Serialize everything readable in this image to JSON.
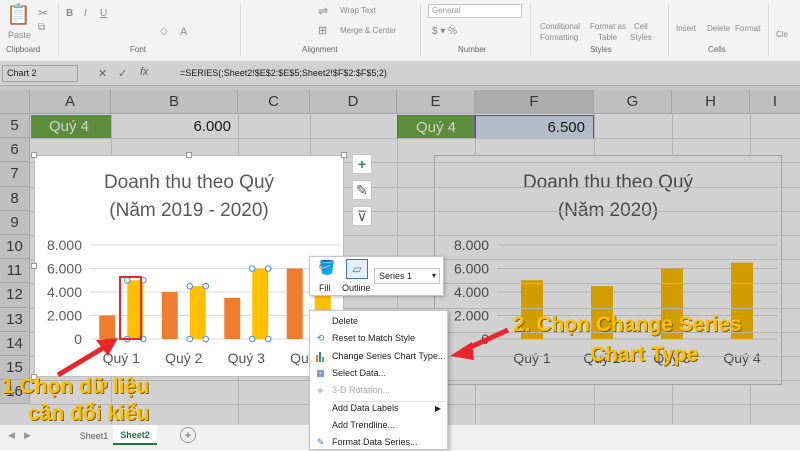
{
  "ribbon": {
    "clipboard": {
      "paste": "Paste",
      "group": "Clipboard"
    },
    "font": {
      "group": "Font"
    },
    "alignment": {
      "wrap_text": "Wrap Text",
      "merge_center": "Merge & Center",
      "group": "Alignment"
    },
    "number": {
      "format": "General",
      "group": "Number"
    },
    "styles": {
      "conditional": "Conditional",
      "formatting": "Formatting",
      "format_as": "Format as",
      "table": "Table",
      "cell": "Cell",
      "styles_lbl": "Styles",
      "group": "Styles"
    },
    "cells": {
      "insert": "Insert",
      "delete": "Delete",
      "format": "Format",
      "group": "Cells"
    },
    "clear": "Cle"
  },
  "formula_bar": {
    "name_box": "Chart 2",
    "formula": "=SERIES(;Sheet2!$E$2:$E$5;Sheet2!$F$2:$F$5;2)"
  },
  "columns": [
    "A",
    "B",
    "C",
    "D",
    "E",
    "F",
    "G",
    "H",
    "I"
  ],
  "rows": [
    "5",
    "6",
    "7",
    "8",
    "9",
    "10",
    "11",
    "12",
    "13",
    "14",
    "15",
    "16"
  ],
  "cells": {
    "A5": "Quý 4",
    "B5": "6.000",
    "E5": "Quý 4",
    "F5": "6.500"
  },
  "chart1": {
    "title_line1": "Doanh thu theo Quý",
    "title_line2": "(Năm 2019 - 2020)",
    "yticks": [
      "8.000",
      "6.000",
      "4.000",
      "2.000",
      "0"
    ],
    "categories": [
      "Quý 1",
      "Quý 2",
      "Quý 3",
      "Quý 4"
    ]
  },
  "chart2": {
    "title_line1": "Doanh thu theo Quý",
    "title_line2": "(Năm 2020)",
    "yticks": [
      "8.000",
      "6.000",
      "4.000",
      "2.000",
      "0"
    ],
    "categories": [
      "Quý 1",
      "Quý 2",
      "Quý 3",
      "Quý 4"
    ]
  },
  "chart_data": [
    {
      "type": "bar",
      "title": "Doanh thu theo Quý (Năm 2019 - 2020)",
      "categories": [
        "Quý 1",
        "Quý 2",
        "Quý 3",
        "Quý 4"
      ],
      "series": [
        {
          "values": [
            2000,
            4000,
            3500,
            6000
          ],
          "color": "#ed7d31"
        },
        {
          "values": [
            5000,
            4500,
            6000,
            6500
          ],
          "color": "#ffc000"
        }
      ],
      "ylim": [
        0,
        8000
      ],
      "grid": true
    },
    {
      "type": "bar",
      "title": "Doanh thu theo Quý (Năm 2020)",
      "categories": [
        "Quý 1",
        "Quý 2",
        "Quý 3",
        "Quý 4"
      ],
      "series": [
        {
          "values": [
            5000,
            4500,
            6000,
            6500
          ],
          "color": "#ffc000"
        }
      ],
      "ylim": [
        0,
        8000
      ],
      "grid": true
    }
  ],
  "mini_toolbar": {
    "fill": "Fill",
    "outline": "Outline",
    "series_select": "Series 1"
  },
  "context_menu": {
    "items": [
      {
        "label": "Delete",
        "icon": "",
        "disabled": false
      },
      {
        "label": "Reset to Match Style",
        "icon": "reset-icon",
        "disabled": false
      },
      {
        "label": "Change Series Chart Type...",
        "icon": "chart-icon",
        "disabled": false
      },
      {
        "label": "Select Data...",
        "icon": "select-data-icon",
        "disabled": false
      },
      {
        "label": "3-D Rotation...",
        "icon": "rotation-icon",
        "disabled": true
      },
      {
        "label": "Add Data Labels",
        "icon": "",
        "disabled": false,
        "submenu": true
      },
      {
        "label": "Add Trendline...",
        "icon": "",
        "disabled": false
      },
      {
        "label": "Format Data Series...",
        "icon": "format-icon",
        "disabled": false
      }
    ]
  },
  "annotations": {
    "step1_line1": "1 Chọn dữ liệu",
    "step1_line2": "cần đổi kiểu",
    "step2_line1": "2. Chọn Change Series",
    "step2_line2": "Chart Type"
  },
  "sheets": [
    "Sheet1",
    "Sheet2"
  ],
  "colors": {
    "accent_green": "#70ad47",
    "orange": "#ed7d31",
    "gold": "#ffc000",
    "highlight_red": "#e8262b",
    "annotation_yellow": "#ffc000"
  }
}
